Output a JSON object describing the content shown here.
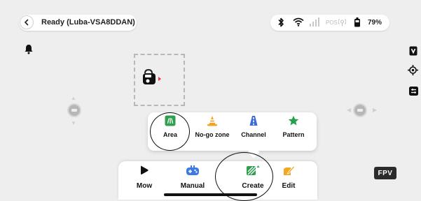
{
  "header": {
    "status_text": "Ready  (Luba-VSA8DDAN)",
    "pos_label": "POS",
    "battery_text": "79%"
  },
  "create_menu": [
    {
      "label": "Area",
      "icon": "area-icon"
    },
    {
      "label": "No-go zone",
      "icon": "no-go-zone-icon"
    },
    {
      "label": "Channel",
      "icon": "channel-icon"
    },
    {
      "label": "Pattern",
      "icon": "pattern-icon"
    }
  ],
  "bottom_nav": [
    {
      "label": "Mow",
      "icon": "play-icon"
    },
    {
      "label": "Manual",
      "icon": "gamepad-icon"
    },
    {
      "label": "Create",
      "icon": "create-icon"
    },
    {
      "label": "Edit",
      "icon": "edit-icon"
    }
  ],
  "fpv_label": "FPV",
  "colors": {
    "area_green": "#2e9e4f",
    "nogo_orange": "#f4a223",
    "channel_blue": "#3b6bd6",
    "pattern_green": "#23a04a",
    "manual_blue": "#3d7be0",
    "edit_orange": "#f5a623"
  }
}
